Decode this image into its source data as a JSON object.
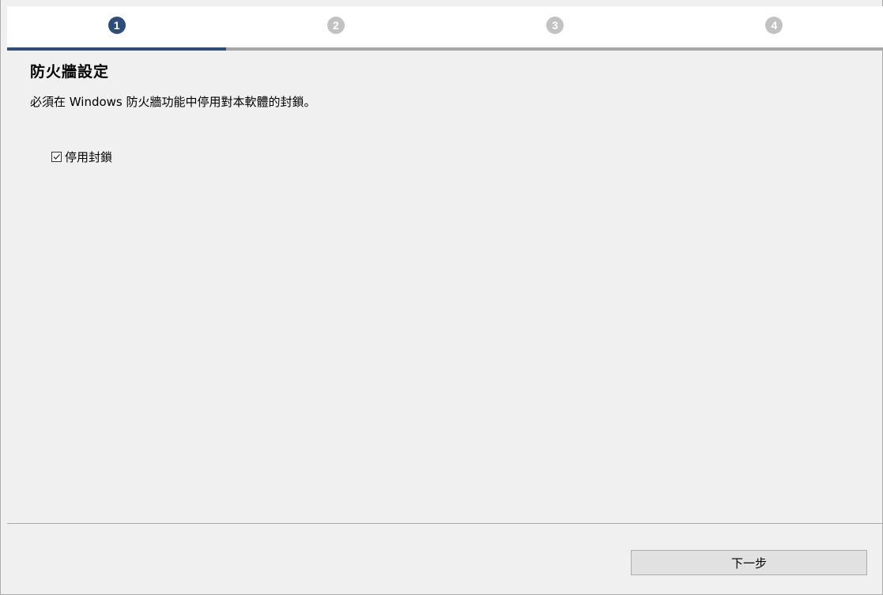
{
  "steps": [
    {
      "number": "1",
      "active": true
    },
    {
      "number": "2",
      "active": false
    },
    {
      "number": "3",
      "active": false
    },
    {
      "number": "4",
      "active": false
    }
  ],
  "content": {
    "title": "防火牆設定",
    "description": "必須在 Windows 防火牆功能中停用對本軟體的封鎖。",
    "checkbox_label": "停用封鎖",
    "checkbox_checked": true
  },
  "footer": {
    "next_label": "下一步"
  },
  "colors": {
    "accent": "#2e4d7b",
    "inactive_step": "#c2c2c2",
    "background": "#f0f0f0"
  }
}
